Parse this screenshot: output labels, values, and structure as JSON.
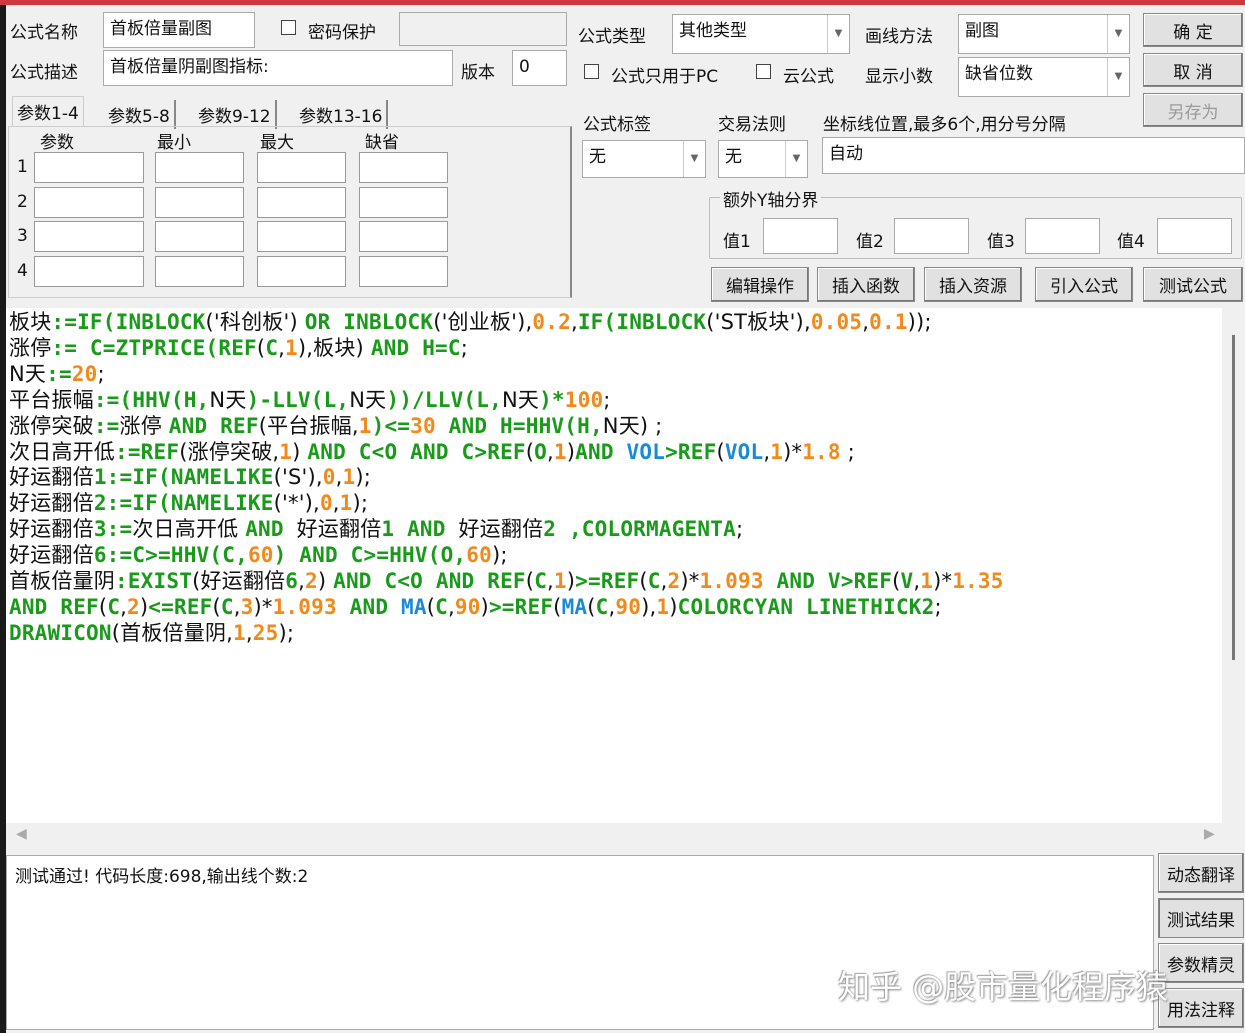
{
  "form": {
    "name_label": "公式名称",
    "name_value": "首板倍量副图",
    "password_label": "密码保护",
    "desc_label": "公式描述",
    "desc_value": "首板倍量阴副图指标:",
    "version_label": "版本",
    "version_value": "0",
    "type_label": "公式类型",
    "type_value": "其他类型",
    "draw_label": "画线方法",
    "draw_value": "副图",
    "pc_only_label": "公式只用于PC",
    "cloud_label": "云公式",
    "decimals_label": "显示小数",
    "decimals_value": "缺省位数",
    "tag_label": "公式标签",
    "tag_value": "无",
    "trade_label": "交易法则",
    "trade_value": "无",
    "axis_label": "坐标线位置,最多6个,用分号分隔",
    "axis_value": "自动",
    "yaxis_group": "额外Y轴分界",
    "y_values": [
      "值1",
      "值2",
      "值3",
      "值4"
    ]
  },
  "buttons": {
    "ok": "确 定",
    "cancel": "取 消",
    "save_as": "另存为",
    "edit": "编辑操作",
    "insert_func": "插入函数",
    "insert_res": "插入资源",
    "import": "引入公式",
    "test": "测试公式",
    "translate": "动态翻译",
    "result": "测试结果",
    "wizard": "参数精灵",
    "usage": "用法注释"
  },
  "tabs": [
    "参数1-4",
    "参数5-8",
    "参数9-12",
    "参数13-16"
  ],
  "params": {
    "headers": [
      "参数",
      "最小",
      "最大",
      "缺省"
    ],
    "rows": [
      "1",
      "2",
      "3",
      "4"
    ]
  },
  "code_lines": [
    [
      [
        "t",
        "板块"
      ],
      [
        "k",
        ":=IF(INBLOCK"
      ],
      [
        "t",
        "('科创板') "
      ],
      [
        "k",
        "OR INBLOCK"
      ],
      [
        "t",
        "('创业板'),"
      ],
      [
        "n",
        "0.2"
      ],
      [
        "t",
        ","
      ],
      [
        "k",
        "IF(INBLOCK"
      ],
      [
        "t",
        "('ST板块'),"
      ],
      [
        "n",
        "0.05"
      ],
      [
        "t",
        ","
      ],
      [
        "n",
        "0.1"
      ],
      [
        "t",
        "));"
      ]
    ],
    [
      [
        "t",
        "涨停"
      ],
      [
        "k",
        ":= C=ZTPRICE(REF"
      ],
      [
        "t",
        "("
      ],
      [
        "k",
        "C"
      ],
      [
        "t",
        ","
      ],
      [
        "n",
        "1"
      ],
      [
        "t",
        "),板块) "
      ],
      [
        "k",
        "AND H=C"
      ],
      [
        "t",
        ";"
      ]
    ],
    [
      [
        "t",
        "N天"
      ],
      [
        "k",
        ":="
      ],
      [
        "n",
        "20"
      ],
      [
        "t",
        ";"
      ]
    ],
    [
      [
        "t",
        "平台振幅"
      ],
      [
        "k",
        ":=(HHV(H,"
      ],
      [
        "t",
        "N天"
      ],
      [
        "k",
        ")-LLV(L,"
      ],
      [
        "t",
        "N天"
      ],
      [
        "k",
        "))/LLV(L,"
      ],
      [
        "t",
        "N天"
      ],
      [
        "k",
        ")*"
      ],
      [
        "n",
        "100"
      ],
      [
        "t",
        ";"
      ]
    ],
    [
      [
        "t",
        "涨停突破"
      ],
      [
        "k",
        ":="
      ],
      [
        "t",
        "涨停 "
      ],
      [
        "k",
        "AND REF"
      ],
      [
        "t",
        "(平台振幅,"
      ],
      [
        "n",
        "1"
      ],
      [
        "k",
        ")<="
      ],
      [
        "n",
        "30"
      ],
      [
        "k",
        " AND H=HHV(H,"
      ],
      [
        "t",
        "N天) ;"
      ]
    ],
    [
      [
        "t",
        "次日高开低"
      ],
      [
        "k",
        ":=REF"
      ],
      [
        "t",
        "(涨停突破,"
      ],
      [
        "n",
        "1"
      ],
      [
        "t",
        ") "
      ],
      [
        "k",
        "AND C<O AND C>REF"
      ],
      [
        "t",
        "("
      ],
      [
        "k",
        "O"
      ],
      [
        "t",
        ","
      ],
      [
        "n",
        "1"
      ],
      [
        "t",
        ")"
      ],
      [
        "k",
        "AND "
      ],
      [
        "b",
        "VOL"
      ],
      [
        "k",
        ">REF"
      ],
      [
        "t",
        "("
      ],
      [
        "b",
        "VOL"
      ],
      [
        "t",
        ","
      ],
      [
        "n",
        "1"
      ],
      [
        "t",
        ")*"
      ],
      [
        "n",
        "1.8"
      ],
      [
        "t",
        " ;"
      ]
    ],
    [
      [
        "t",
        "好运翻倍"
      ],
      [
        "k",
        "1:=IF(NAMELIKE"
      ],
      [
        "t",
        "('S'),"
      ],
      [
        "n",
        "0"
      ],
      [
        "t",
        ","
      ],
      [
        "n",
        "1"
      ],
      [
        "t",
        ");"
      ]
    ],
    [
      [
        "t",
        "好运翻倍"
      ],
      [
        "k",
        "2:=IF(NAMELIKE"
      ],
      [
        "t",
        "('*'),"
      ],
      [
        "n",
        "0"
      ],
      [
        "t",
        ","
      ],
      [
        "n",
        "1"
      ],
      [
        "t",
        ");"
      ]
    ],
    [
      [
        "t",
        "好运翻倍"
      ],
      [
        "k",
        "3:="
      ],
      [
        "t",
        "次日高开低 "
      ],
      [
        "k",
        "AND "
      ],
      [
        "t",
        "好运翻倍"
      ],
      [
        "k",
        "1 AND "
      ],
      [
        "t",
        "好运翻倍"
      ],
      [
        "k",
        "2 ,COLORMAGENTA"
      ],
      [
        "t",
        ";"
      ]
    ],
    [
      [
        "t",
        "好运翻倍"
      ],
      [
        "k",
        "6:=C>=HHV(C,"
      ],
      [
        "n",
        "60"
      ],
      [
        "k",
        ") AND C>=HHV(O,"
      ],
      [
        "n",
        "60"
      ],
      [
        "t",
        ");"
      ]
    ],
    [
      [
        "t",
        "首板倍量阴"
      ],
      [
        "k",
        ":EXIST"
      ],
      [
        "t",
        "(好运翻倍"
      ],
      [
        "k",
        "6"
      ],
      [
        "t",
        ","
      ],
      [
        "n",
        "2"
      ],
      [
        "t",
        ") "
      ],
      [
        "k",
        "AND C<O AND REF"
      ],
      [
        "t",
        "("
      ],
      [
        "k",
        "C"
      ],
      [
        "t",
        ","
      ],
      [
        "n",
        "1"
      ],
      [
        "t",
        ")"
      ],
      [
        "k",
        ">=REF"
      ],
      [
        "t",
        "("
      ],
      [
        "k",
        "C"
      ],
      [
        "t",
        ","
      ],
      [
        "n",
        "2"
      ],
      [
        "t",
        ")*"
      ],
      [
        "n",
        "1.093"
      ],
      [
        "k",
        " AND V>REF"
      ],
      [
        "t",
        "("
      ],
      [
        "k",
        "V"
      ],
      [
        "t",
        ","
      ],
      [
        "n",
        "1"
      ],
      [
        "t",
        ")*"
      ],
      [
        "n",
        "1.35"
      ]
    ],
    [
      [
        "k",
        "AND REF"
      ],
      [
        "t",
        "("
      ],
      [
        "k",
        "C"
      ],
      [
        "t",
        ","
      ],
      [
        "n",
        "2"
      ],
      [
        "t",
        ")"
      ],
      [
        "k",
        "<=REF"
      ],
      [
        "t",
        "("
      ],
      [
        "k",
        "C"
      ],
      [
        "t",
        ","
      ],
      [
        "n",
        "3"
      ],
      [
        "t",
        ")*"
      ],
      [
        "n",
        "1.093"
      ],
      [
        "k",
        " AND "
      ],
      [
        "b",
        "MA"
      ],
      [
        "t",
        "("
      ],
      [
        "k",
        "C"
      ],
      [
        "t",
        ","
      ],
      [
        "n",
        "90"
      ],
      [
        "t",
        ")"
      ],
      [
        "k",
        ">=REF"
      ],
      [
        "t",
        "("
      ],
      [
        "b",
        "MA"
      ],
      [
        "t",
        "("
      ],
      [
        "k",
        "C"
      ],
      [
        "t",
        ","
      ],
      [
        "n",
        "90"
      ],
      [
        "t",
        "),"
      ],
      [
        "n",
        "1"
      ],
      [
        "t",
        ")"
      ],
      [
        "k",
        "COLORCYAN LINETHICK2"
      ],
      [
        "t",
        ";"
      ]
    ],
    [
      [
        "k",
        "DRAWICON"
      ],
      [
        "t",
        "(首板倍量阴,"
      ],
      [
        "n",
        "1"
      ],
      [
        "t",
        ","
      ],
      [
        "n",
        "25"
      ],
      [
        "t",
        ");"
      ]
    ]
  ],
  "status": "测试通过! 代码长度:698,输出线个数:2",
  "watermark": "知乎 @股市量化程序猿",
  "colors": {
    "keyword": "#1a9a1a",
    "number": "#f08a1c",
    "builtin": "#1b8ad6",
    "titlebar": "#d0373f"
  }
}
